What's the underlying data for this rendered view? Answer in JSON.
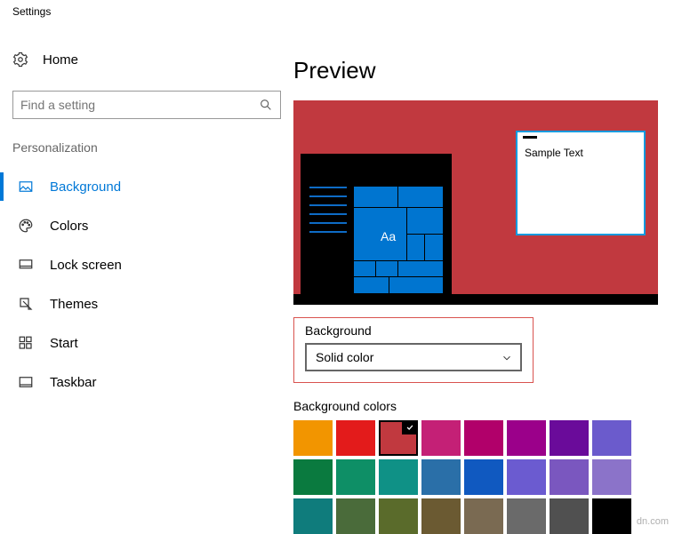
{
  "app_title": "Settings",
  "home_label": "Home",
  "search": {
    "placeholder": "Find a setting"
  },
  "section_label": "Personalization",
  "nav": {
    "background": "Background",
    "colors": "Colors",
    "lockscreen": "Lock screen",
    "themes": "Themes",
    "start": "Start",
    "taskbar": "Taskbar"
  },
  "content": {
    "preview_heading": "Preview",
    "preview": {
      "aa": "Aa",
      "sample_text": "Sample Text"
    },
    "bg_label": "Background",
    "bg_dropdown_value": "Solid color",
    "bg_colors_label": "Background colors",
    "selected_color_index": 2,
    "colors": [
      "#f29500",
      "#e31b1b",
      "#c1393f",
      "#c42076",
      "#b1006a",
      "#9b008a",
      "#6a0b9a",
      "#6b5bcc",
      "#0a7a3f",
      "#0e8f66",
      "#0f9186",
      "#2a6fa8",
      "#1059c0",
      "#6b5bd0",
      "#7a57bf",
      "#8b73c9",
      "#0f7c7c",
      "#4a6b3a",
      "#5a6b2b",
      "#6b5a32",
      "#7a6a52",
      "#6a6a6a",
      "#505050",
      "#000000"
    ]
  },
  "watermark": "dn.com"
}
